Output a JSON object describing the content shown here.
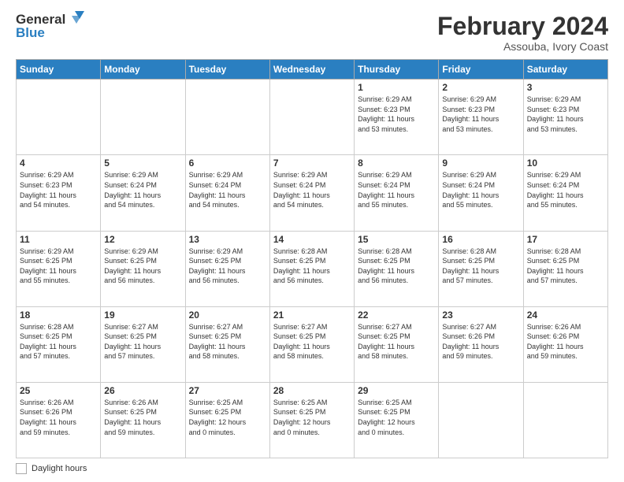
{
  "header": {
    "logo_line1": "General",
    "logo_line2": "Blue",
    "main_title": "February 2024",
    "subtitle": "Assouba, Ivory Coast"
  },
  "weekdays": [
    "Sunday",
    "Monday",
    "Tuesday",
    "Wednesday",
    "Thursday",
    "Friday",
    "Saturday"
  ],
  "weeks": [
    [
      {
        "day": "",
        "info": ""
      },
      {
        "day": "",
        "info": ""
      },
      {
        "day": "",
        "info": ""
      },
      {
        "day": "",
        "info": ""
      },
      {
        "day": "1",
        "info": "Sunrise: 6:29 AM\nSunset: 6:23 PM\nDaylight: 11 hours\nand 53 minutes."
      },
      {
        "day": "2",
        "info": "Sunrise: 6:29 AM\nSunset: 6:23 PM\nDaylight: 11 hours\nand 53 minutes."
      },
      {
        "day": "3",
        "info": "Sunrise: 6:29 AM\nSunset: 6:23 PM\nDaylight: 11 hours\nand 53 minutes."
      }
    ],
    [
      {
        "day": "4",
        "info": "Sunrise: 6:29 AM\nSunset: 6:23 PM\nDaylight: 11 hours\nand 54 minutes."
      },
      {
        "day": "5",
        "info": "Sunrise: 6:29 AM\nSunset: 6:24 PM\nDaylight: 11 hours\nand 54 minutes."
      },
      {
        "day": "6",
        "info": "Sunrise: 6:29 AM\nSunset: 6:24 PM\nDaylight: 11 hours\nand 54 minutes."
      },
      {
        "day": "7",
        "info": "Sunrise: 6:29 AM\nSunset: 6:24 PM\nDaylight: 11 hours\nand 54 minutes."
      },
      {
        "day": "8",
        "info": "Sunrise: 6:29 AM\nSunset: 6:24 PM\nDaylight: 11 hours\nand 55 minutes."
      },
      {
        "day": "9",
        "info": "Sunrise: 6:29 AM\nSunset: 6:24 PM\nDaylight: 11 hours\nand 55 minutes."
      },
      {
        "day": "10",
        "info": "Sunrise: 6:29 AM\nSunset: 6:24 PM\nDaylight: 11 hours\nand 55 minutes."
      }
    ],
    [
      {
        "day": "11",
        "info": "Sunrise: 6:29 AM\nSunset: 6:25 PM\nDaylight: 11 hours\nand 55 minutes."
      },
      {
        "day": "12",
        "info": "Sunrise: 6:29 AM\nSunset: 6:25 PM\nDaylight: 11 hours\nand 56 minutes."
      },
      {
        "day": "13",
        "info": "Sunrise: 6:29 AM\nSunset: 6:25 PM\nDaylight: 11 hours\nand 56 minutes."
      },
      {
        "day": "14",
        "info": "Sunrise: 6:28 AM\nSunset: 6:25 PM\nDaylight: 11 hours\nand 56 minutes."
      },
      {
        "day": "15",
        "info": "Sunrise: 6:28 AM\nSunset: 6:25 PM\nDaylight: 11 hours\nand 56 minutes."
      },
      {
        "day": "16",
        "info": "Sunrise: 6:28 AM\nSunset: 6:25 PM\nDaylight: 11 hours\nand 57 minutes."
      },
      {
        "day": "17",
        "info": "Sunrise: 6:28 AM\nSunset: 6:25 PM\nDaylight: 11 hours\nand 57 minutes."
      }
    ],
    [
      {
        "day": "18",
        "info": "Sunrise: 6:28 AM\nSunset: 6:25 PM\nDaylight: 11 hours\nand 57 minutes."
      },
      {
        "day": "19",
        "info": "Sunrise: 6:27 AM\nSunset: 6:25 PM\nDaylight: 11 hours\nand 57 minutes."
      },
      {
        "day": "20",
        "info": "Sunrise: 6:27 AM\nSunset: 6:25 PM\nDaylight: 11 hours\nand 58 minutes."
      },
      {
        "day": "21",
        "info": "Sunrise: 6:27 AM\nSunset: 6:25 PM\nDaylight: 11 hours\nand 58 minutes."
      },
      {
        "day": "22",
        "info": "Sunrise: 6:27 AM\nSunset: 6:25 PM\nDaylight: 11 hours\nand 58 minutes."
      },
      {
        "day": "23",
        "info": "Sunrise: 6:27 AM\nSunset: 6:26 PM\nDaylight: 11 hours\nand 59 minutes."
      },
      {
        "day": "24",
        "info": "Sunrise: 6:26 AM\nSunset: 6:26 PM\nDaylight: 11 hours\nand 59 minutes."
      }
    ],
    [
      {
        "day": "25",
        "info": "Sunrise: 6:26 AM\nSunset: 6:26 PM\nDaylight: 11 hours\nand 59 minutes."
      },
      {
        "day": "26",
        "info": "Sunrise: 6:26 AM\nSunset: 6:25 PM\nDaylight: 11 hours\nand 59 minutes."
      },
      {
        "day": "27",
        "info": "Sunrise: 6:25 AM\nSunset: 6:25 PM\nDaylight: 12 hours\nand 0 minutes."
      },
      {
        "day": "28",
        "info": "Sunrise: 6:25 AM\nSunset: 6:25 PM\nDaylight: 12 hours\nand 0 minutes."
      },
      {
        "day": "29",
        "info": "Sunrise: 6:25 AM\nSunset: 6:25 PM\nDaylight: 12 hours\nand 0 minutes."
      },
      {
        "day": "",
        "info": ""
      },
      {
        "day": "",
        "info": ""
      }
    ]
  ],
  "legend": {
    "label": "Daylight hours"
  }
}
